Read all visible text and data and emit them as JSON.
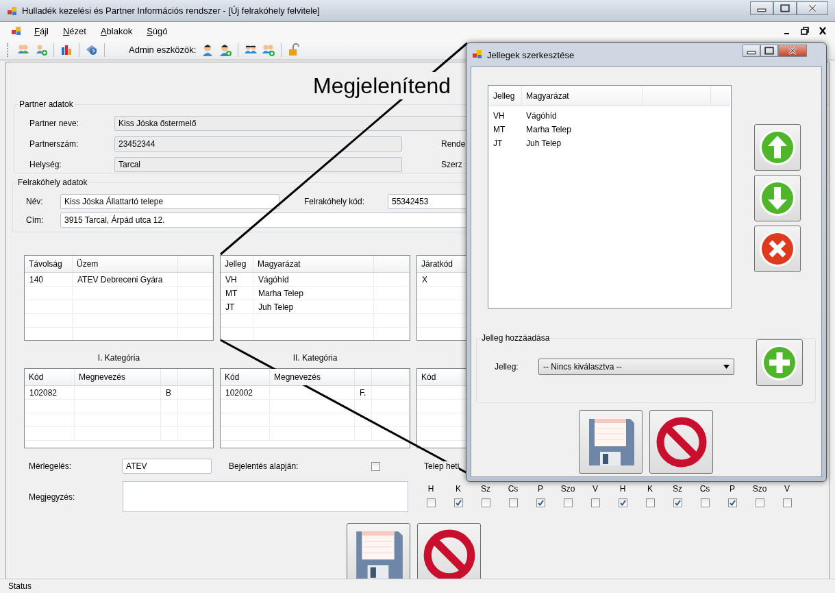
{
  "window": {
    "title": "Hulladék kezelési és Partner Információs rendszer - [Új felrakóhely felvitele]"
  },
  "menu": [
    {
      "label": "Fájl"
    },
    {
      "label": "Nézet"
    },
    {
      "label": "Ablakok"
    },
    {
      "label": "Súgó"
    }
  ],
  "toolbar": {
    "label": "Admin eszközök:"
  },
  "heading": "Megjelenítend",
  "partner": {
    "title": "Partner adatok",
    "fields": [
      {
        "label": "Partner neve:",
        "value": "Kiss Jóska őstermelő"
      },
      {
        "label": "Partnerszám:",
        "value": "23452344",
        "side_label": "Rende"
      },
      {
        "label": "Helység:",
        "value": "Tarcal",
        "side_label": "Szerz"
      }
    ]
  },
  "site": {
    "title": "Felrakóhely adatok",
    "name": {
      "label": "Név:",
      "value": "Kiss Jóska Állattartó telepe"
    },
    "code": {
      "label": "Felrakóhely kód:",
      "value": "55342453"
    },
    "address": {
      "label": "Cím:",
      "value": "3915 Tarcal, Árpád utca 12."
    }
  },
  "lists": [
    {
      "columns": [
        "Távolság",
        "Üzem"
      ],
      "rows": [
        [
          "140",
          "ATEV Debreceni Gyára"
        ]
      ]
    },
    {
      "columns": [
        "Jelleg",
        "Magyarázat"
      ],
      "rows": [
        [
          "VH",
          "Vágóhíd"
        ],
        [
          "MT",
          "Marha Telep"
        ],
        [
          "JT",
          "Juh Telep"
        ]
      ]
    },
    {
      "columns": [
        "Járatkód"
      ],
      "rows": [
        [
          "X"
        ]
      ]
    }
  ],
  "categories": [
    {
      "title": "I. Kategória",
      "columns": [
        "Kód",
        "Megnevezés"
      ],
      "rows": [
        [
          "102082",
          null,
          "B"
        ]
      ]
    },
    {
      "title": "II. Kategória",
      "columns": [
        "Kód",
        "Megnevezés"
      ],
      "rows": [
        [
          "102002",
          null,
          "F."
        ]
      ]
    },
    {
      "columns": [
        "Kód"
      ]
    }
  ],
  "weighing": {
    "label": "Mérlegelés:",
    "value": "ATEV"
  },
  "report": {
    "label": "Bejelentés alapján:",
    "checked": false
  },
  "schedule": {
    "label": "Telep heti",
    "days": [
      {
        "label": "H",
        "checked": false
      },
      {
        "label": "K",
        "checked": true
      },
      {
        "label": "Sz",
        "checked": false
      },
      {
        "label": "Cs",
        "checked": false
      },
      {
        "label": "P",
        "checked": true
      },
      {
        "label": "Szo",
        "checked": false
      },
      {
        "label": "V",
        "checked": false
      },
      {
        "label": "H",
        "checked": true
      },
      {
        "label": "K",
        "checked": false
      },
      {
        "label": "Sz",
        "checked": true
      },
      {
        "label": "Cs",
        "checked": false
      },
      {
        "label": "P",
        "checked": true
      },
      {
        "label": "Szo",
        "checked": false
      },
      {
        "label": "V",
        "checked": false
      }
    ]
  },
  "note": {
    "label": "Megjegyzés:"
  },
  "actions": [
    {
      "kind": "save"
    },
    {
      "kind": "cancel"
    }
  ],
  "status_bar": "Status",
  "dialog": {
    "title": "Jellegek szerkesztése",
    "list": {
      "columns": [
        "Jelleg",
        "Magyarázat"
      ],
      "rows": [
        [
          "VH",
          "Vágóhíd"
        ],
        [
          "MT",
          "Marha Telep"
        ],
        [
          "JT",
          "Juh Telep"
        ]
      ]
    },
    "side_buttons": [
      {
        "kind": "up"
      },
      {
        "kind": "down"
      },
      {
        "kind": "delete"
      }
    ],
    "add_group": {
      "title": "Jelleg hozzáadása",
      "label": "Jelleg:",
      "value": "-- Nincs kiválasztva --",
      "button": {
        "kind": "add"
      }
    },
    "actions": [
      {
        "kind": "save"
      },
      {
        "kind": "cancel"
      }
    ]
  }
}
